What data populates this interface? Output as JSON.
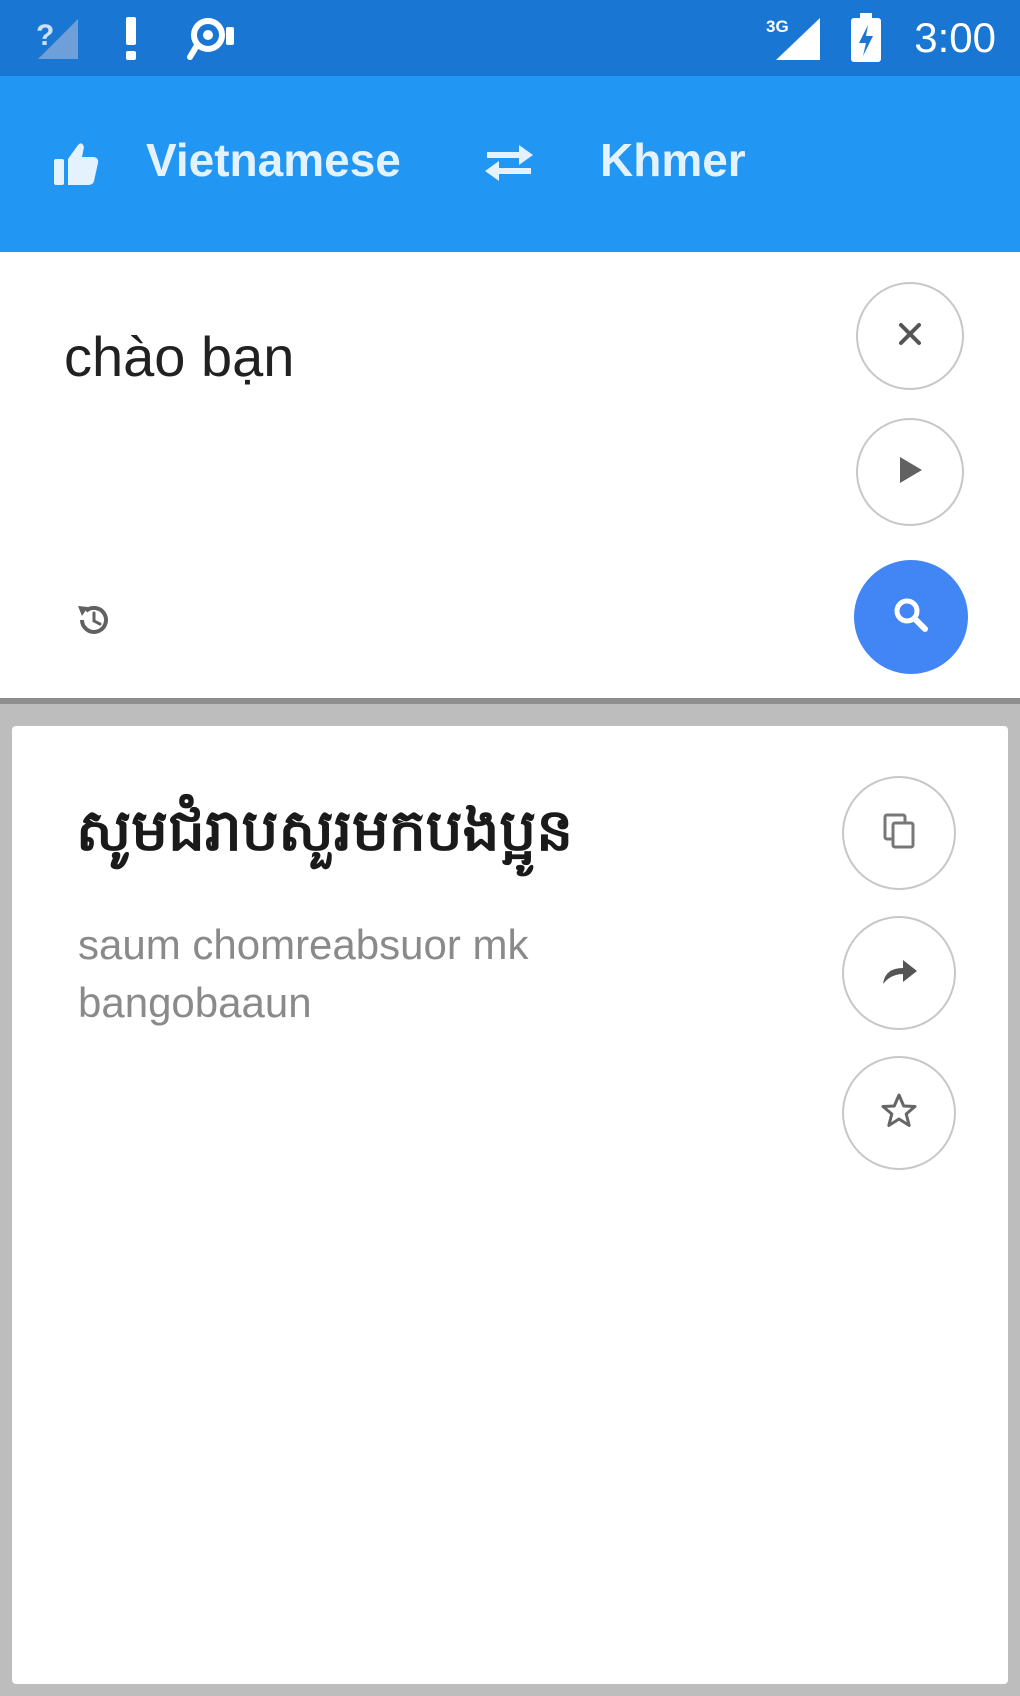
{
  "status_bar": {
    "time": "3:00",
    "icons": [
      "signal-question-icon",
      "alert-icon",
      "location-icon",
      "cell-3g-signal-icon",
      "battery-charging-icon"
    ]
  },
  "app_bar": {
    "source_language": "Vietnamese",
    "target_language": "Khmer",
    "icons": [
      "thumbs-up-icon",
      "swap-icon"
    ]
  },
  "input": {
    "text": "chào bạn",
    "icons": [
      "clear-icon",
      "play-icon",
      "history-icon",
      "search-icon"
    ]
  },
  "result": {
    "translation": "សូមជំរាបសួរមកបងប្អូន",
    "romanization": "saum chomreabsuor mk bangobaaun",
    "icons": [
      "copy-icon",
      "share-icon",
      "star-icon"
    ]
  },
  "colors": {
    "status_bar": "#1976d2",
    "app_bar": "#2196f3",
    "search_button": "#4285f4"
  }
}
